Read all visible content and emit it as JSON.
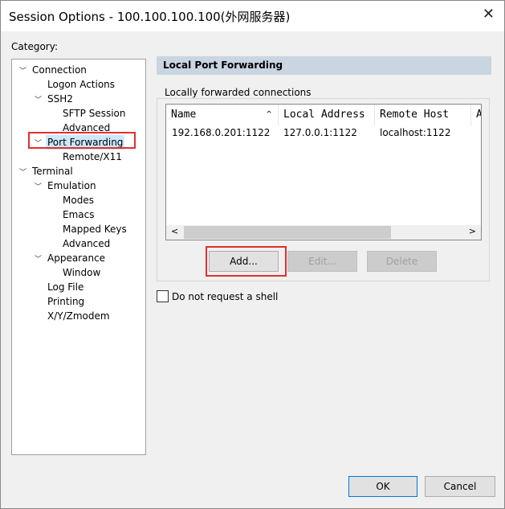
{
  "window": {
    "title": "Session Options - 100.100.100.100(外网服务器)",
    "close": "✕"
  },
  "category_label": "Category:",
  "tree": [
    {
      "label": "Connection",
      "level": 0,
      "expanded": true
    },
    {
      "label": "Logon Actions",
      "level": 1
    },
    {
      "label": "SSH2",
      "level": 1,
      "expanded": true
    },
    {
      "label": "SFTP Session",
      "level": 2
    },
    {
      "label": "Advanced",
      "level": 2
    },
    {
      "label": "Port Forwarding",
      "level": 1,
      "expanded": true,
      "selected": true
    },
    {
      "label": "Remote/X11",
      "level": 2
    },
    {
      "label": "Terminal",
      "level": 0,
      "expanded": true
    },
    {
      "label": "Emulation",
      "level": 1,
      "expanded": true
    },
    {
      "label": "Modes",
      "level": 2
    },
    {
      "label": "Emacs",
      "level": 2
    },
    {
      "label": "Mapped Keys",
      "level": 2
    },
    {
      "label": "Advanced",
      "level": 2
    },
    {
      "label": "Appearance",
      "level": 1,
      "expanded": true
    },
    {
      "label": "Window",
      "level": 2
    },
    {
      "label": "Log File",
      "level": 1
    },
    {
      "label": "Printing",
      "level": 1
    },
    {
      "label": "X/Y/Zmodem",
      "level": 1
    }
  ],
  "panel": {
    "header": "Local Port Forwarding",
    "group_label": "Locally forwarded connections",
    "columns": [
      "Name",
      "Local Address",
      "Remote Host",
      "A"
    ],
    "rows": [
      [
        "192.168.0.201:1122",
        "127.0.0.1:1122",
        "localhost:1122"
      ]
    ],
    "add": "Add...",
    "edit": "Edit...",
    "delete": "Delete",
    "no_shell": "Do not request a shell"
  },
  "footer": {
    "ok": "OK",
    "cancel": "Cancel"
  },
  "colors": {
    "highlight": "#e03030",
    "selection": "#cce8ff",
    "header": "#c9d5e1"
  }
}
